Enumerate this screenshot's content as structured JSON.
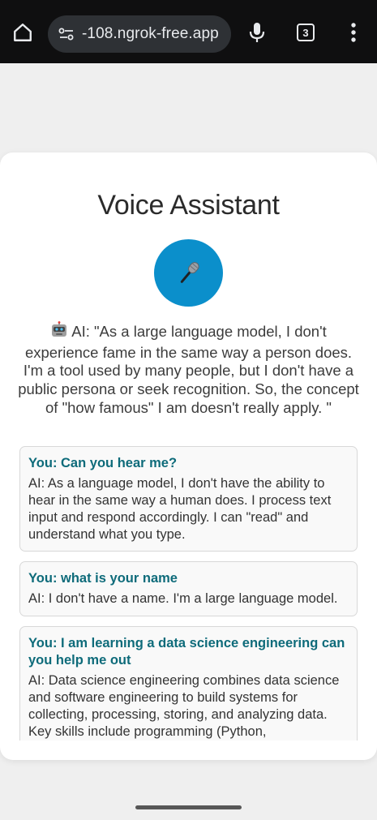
{
  "browser": {
    "url": "-108.ngrok-free.app",
    "tab_count": "3"
  },
  "app": {
    "title": "Voice Assistant",
    "mic_button_icon": "microphone-icon",
    "current_response": "AI: \"As a large language model, I don't experience fame in the same way a person does. I'm a tool used by many people, but I don't have a public persona or seek recognition. So, the concept of \"how famous\" I am doesn't really apply. \""
  },
  "history": [
    {
      "you": "You: Can you hear me?",
      "ai": "AI: As a language model, I don't have the ability to hear in the same way a human does. I process text input and respond accordingly. I can \"read\" and understand what you type."
    },
    {
      "you": "You: what is your name",
      "ai": "AI: I don't have a name. I'm a large language model."
    },
    {
      "you": "You: I am learning a data science engineering can you help me out",
      "ai": "AI: Data science engineering combines data science and software engineering to build systems for collecting, processing, storing, and analyzing data. Key skills include programming (Python,"
    }
  ],
  "colors": {
    "accent": "#0b8fcb",
    "user_text": "#0e6b7a"
  }
}
